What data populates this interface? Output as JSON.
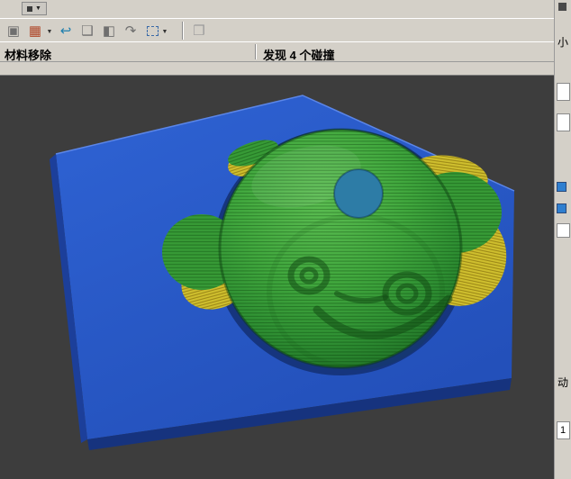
{
  "toolbar": {
    "overflow_glyph": "▼",
    "dropdown_glyph": "▼",
    "buttons": [
      {
        "label": "display-options",
        "glyph": "▣"
      },
      {
        "label": "compare",
        "glyph": "▦"
      },
      {
        "label": "reset",
        "glyph": "↩"
      },
      {
        "label": "facet-bodies",
        "glyph": "❑"
      },
      {
        "label": "create-stock",
        "glyph": "◧"
      },
      {
        "label": "analyze",
        "glyph": "↷"
      },
      {
        "label": "selection-box",
        "glyph": ""
      },
      {
        "label": "solid-box",
        "glyph": "❒"
      }
    ]
  },
  "statusbar": {
    "mode": "材料移除",
    "collision": "发现 4 个碰撞",
    "collision_count": "4"
  },
  "right_panel": {
    "top_fragment": "小",
    "mid_fragment": "动",
    "value_fragment": "1"
  },
  "viewport": {
    "colors": {
      "background": "#3d3d3d",
      "stock_top": "#2a58c9",
      "stock_left": "#1c3f9a",
      "stock_front": "#16337e",
      "machined_green": "#3aa03a",
      "gouge_yellow": "#cfbf2e",
      "hole_teal": "#2d7ca6",
      "shadow_navy": "#16357e"
    }
  }
}
